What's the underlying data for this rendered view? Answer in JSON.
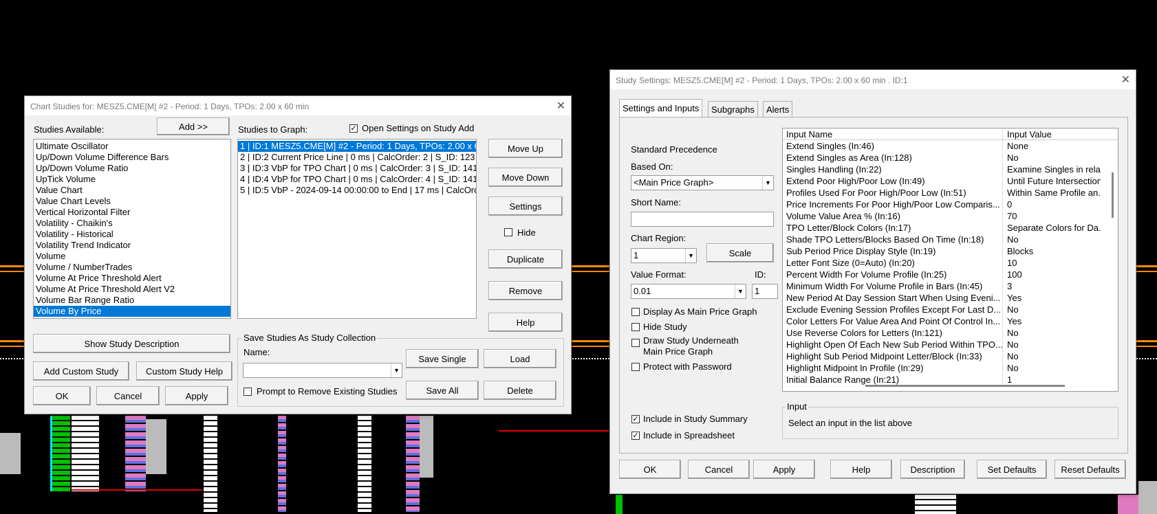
{
  "chart_studies": {
    "title": "Chart Studies for: MESZ5.CME[M] #2 - Period: 1 Days, TPOs: 2.00 x 60 min",
    "studies_available_label": "Studies Available:",
    "add_label": "Add >>",
    "studies_to_graph_label": "Studies to Graph:",
    "open_settings_label": "Open Settings on Study Add",
    "available": [
      "Ultimate Oscillator",
      "Up/Down Volume Difference Bars",
      "Up/Down Volume Ratio",
      "UpTick Volume",
      "Value Chart",
      "Value Chart Levels",
      "Vertical Horizontal Filter",
      "Volatility - Chaikin's",
      "Volatility - Historical",
      "Volatility Trend Indicator",
      "Volume",
      "Volume / NumberTrades",
      "Volume At Price Threshold Alert",
      "Volume At Price Threshold Alert V2",
      "Volume Bar Range Ratio",
      "Volume By Price"
    ],
    "graph": [
      "1 | ID:1  MESZ5.CME[M] #2 - Period: 1 Days, TPOs: 2.00 x 60",
      "2 | ID:2  Current Price Line | 0 ms | CalcOrder: 2 | S_ID: 123",
      "3 | ID:3  VbP for TPO Chart | 0 ms | CalcOrder: 3 | S_ID: 141",
      "4 | ID:4  VbP for TPO Chart | 0 ms | CalcOrder: 4 | S_ID: 141",
      "5 | ID:5  VbP - 2024-09-14  00:00:00 to End | 17 ms | CalcOrde"
    ],
    "move_up": "Move Up",
    "move_down": "Move Down",
    "settings": "Settings",
    "hide": "Hide",
    "duplicate": "Duplicate",
    "remove": "Remove",
    "help": "Help",
    "show_desc": "Show Study Description",
    "add_custom": "Add Custom Study",
    "custom_help": "Custom Study Help",
    "ok": "OK",
    "cancel": "Cancel",
    "apply": "Apply",
    "collection_group": "Save Studies As Study Collection",
    "name_label": "Name:",
    "save_single": "Save Single",
    "load": "Load",
    "prompt_remove": "Prompt to Remove Existing Studies",
    "save_all": "Save All",
    "delete": "Delete"
  },
  "study_settings": {
    "title": "Study Settings: MESZ5.CME[M] #2 - Period: 1 Days, TPOs: 2.00 x 60 min  . ID:1",
    "tabs": [
      "Settings and Inputs",
      "Subgraphs",
      "Alerts"
    ],
    "standard_precedence": "Standard Precedence",
    "based_on_label": "Based On:",
    "based_on_value": "<Main Price Graph>",
    "short_name_label": "Short Name:",
    "chart_region_label": "Chart Region:",
    "chart_region_value": "1",
    "scale": "Scale",
    "value_format_label": "Value Format:",
    "value_format_value": "0.01",
    "id_label": "ID:",
    "id_value": "1",
    "display_main": "Display As Main Price Graph",
    "hide_study": "Hide Study",
    "draw_under_1": "Draw Study Underneath",
    "draw_under_2": "Main Price Graph",
    "protect": "Protect with Password",
    "include_summary": "Include in Study Summary",
    "include_spreadsheet": "Include in Spreadsheet",
    "col_name": "Input Name",
    "col_value": "Input Value",
    "inputs": [
      [
        "Extend Singles   (In:46)",
        "None"
      ],
      [
        "Extend Singles as Area   (In:128)",
        "No"
      ],
      [
        "Singles Handling   (In:22)",
        "Examine Singles in rela"
      ],
      [
        "Extend Poor High/Poor Low   (In:49)",
        "Until Future Intersection"
      ],
      [
        "Profiles Used For Poor High/Poor Low   (In:51)",
        "Within Same Profile an.."
      ],
      [
        "Price Increments For Poor High/Poor Low Comparis...",
        "0"
      ],
      [
        "Volume Value Area %   (In:16)",
        "70"
      ],
      [
        "TPO Letter/Block Colors   (In:17)",
        "Separate Colors for Da."
      ],
      [
        "Shade TPO Letters/Blocks Based On Time   (In:18)",
        "No"
      ],
      [
        "Sub Period Price Display Style   (In:19)",
        "Blocks"
      ],
      [
        "Letter Font Size (0=Auto)   (In:20)",
        "10"
      ],
      [
        "Percent Width For Volume Profile   (In:25)",
        "100"
      ],
      [
        "Minimum Width For Volume Profile in Bars   (In:45)",
        "3"
      ],
      [
        "New Period At Day Session Start When Using Eveni...",
        "Yes"
      ],
      [
        "Exclude Evening Session Profiles Except For Last D...",
        "No"
      ],
      [
        "Color Letters For Value Area And Point Of Control In...",
        "Yes"
      ],
      [
        "Use Reverse Colors for Letters   (In:121)",
        "No"
      ],
      [
        "Highlight Open Of Each New Sub Period Within TPO...",
        "No"
      ],
      [
        "Highlight Sub Period Midpoint Letter/Block   (In:33)",
        "No"
      ],
      [
        "Highlight Midpoint In Profile   (In:29)",
        "No"
      ],
      [
        "Initial Balance Range   (In:21)",
        "1"
      ]
    ],
    "input_group": "Input",
    "input_hint": "Select an input in the list above",
    "ok": "OK",
    "cancel": "Cancel",
    "apply": "Apply",
    "help": "Help",
    "description": "Description",
    "set_defaults": "Set Defaults",
    "reset_defaults": "Reset Defaults"
  },
  "colors": {
    "accent": "#0078d7",
    "chart_orange": "#ff8c00",
    "chart_green": "#00c000",
    "chart_pink": "#e07ac0",
    "chart_grey": "#bbbbbb"
  }
}
